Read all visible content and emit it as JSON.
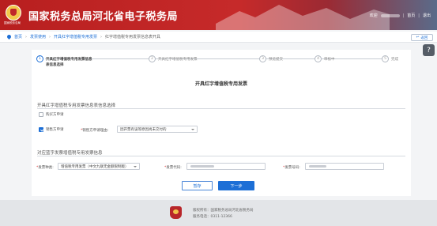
{
  "header": {
    "logo_caption": "国家税务总局",
    "site_title": "国家税务总局河北省电子税务局",
    "welcome": "欢迎",
    "home_link": "首页",
    "logout": "退出"
  },
  "breadcrumb": {
    "items": [
      "首页",
      "发票使用",
      "开具红字增值税专用发票",
      "红字增值税专用发票信息表开具"
    ]
  },
  "back_button": "返回",
  "help_icon": "?",
  "steps": [
    {
      "num": "1",
      "label": "开具红字增值税专用发票信息",
      "sub": "表信息选择",
      "active": true
    },
    {
      "num": "2",
      "label": "开具红字增值税专用发票",
      "active": false
    },
    {
      "num": "3",
      "label": "预览提交",
      "active": false
    },
    {
      "num": "4",
      "label": "审核中",
      "active": false
    },
    {
      "num": "5",
      "label": "完成",
      "active": false
    }
  ],
  "page_heading": "开具红字增值税专用发票",
  "group1": {
    "title": "开具红字增值税专用发票信息表信息选择",
    "buyer_apply": "购买方申请",
    "seller_apply": "销售方申请",
    "reason_label": "销售方申请理由:",
    "reason_value": "因开票有误等原因尚未交付的"
  },
  "group2": {
    "title": "对应蓝字发票增值税专用发票信息",
    "invoice_type_label": "发票种类:",
    "invoice_type_value": "增值税专用发票（中文九联无金额限制版）",
    "invoice_code_label": "发票代码:",
    "invoice_number_label": "发票号码:"
  },
  "buttons": {
    "save": "暂存",
    "next": "下一步"
  },
  "footer": {
    "owner": "版权所有：国家税务总局河北省税务局",
    "hotline": "服务电话：0311-12366"
  }
}
